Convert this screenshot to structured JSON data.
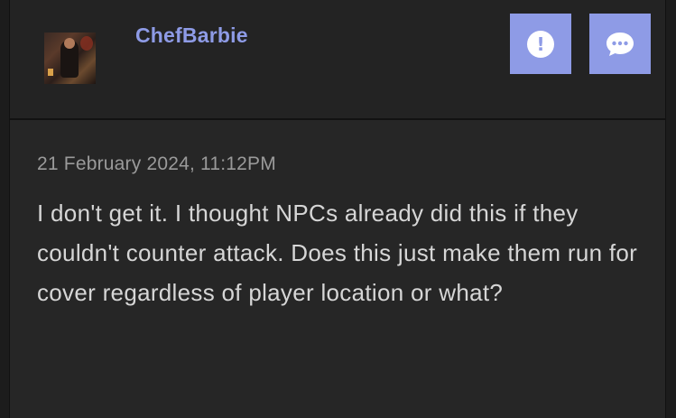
{
  "post": {
    "author": "ChefBarbie",
    "timestamp": "21 February 2024, 11:12PM",
    "body": "I don't get it. I thought NPCs already did this if they couldn't counter attack. Does this just make them run for cover regardless of player location or what?",
    "actions": {
      "report_icon": "exclamation-icon",
      "reply_icon": "speech-bubble-icon"
    }
  },
  "colors": {
    "accent": "#8e9be6",
    "background": "#262626",
    "text": "#d6d6d6",
    "muted": "#9a9a9a"
  }
}
